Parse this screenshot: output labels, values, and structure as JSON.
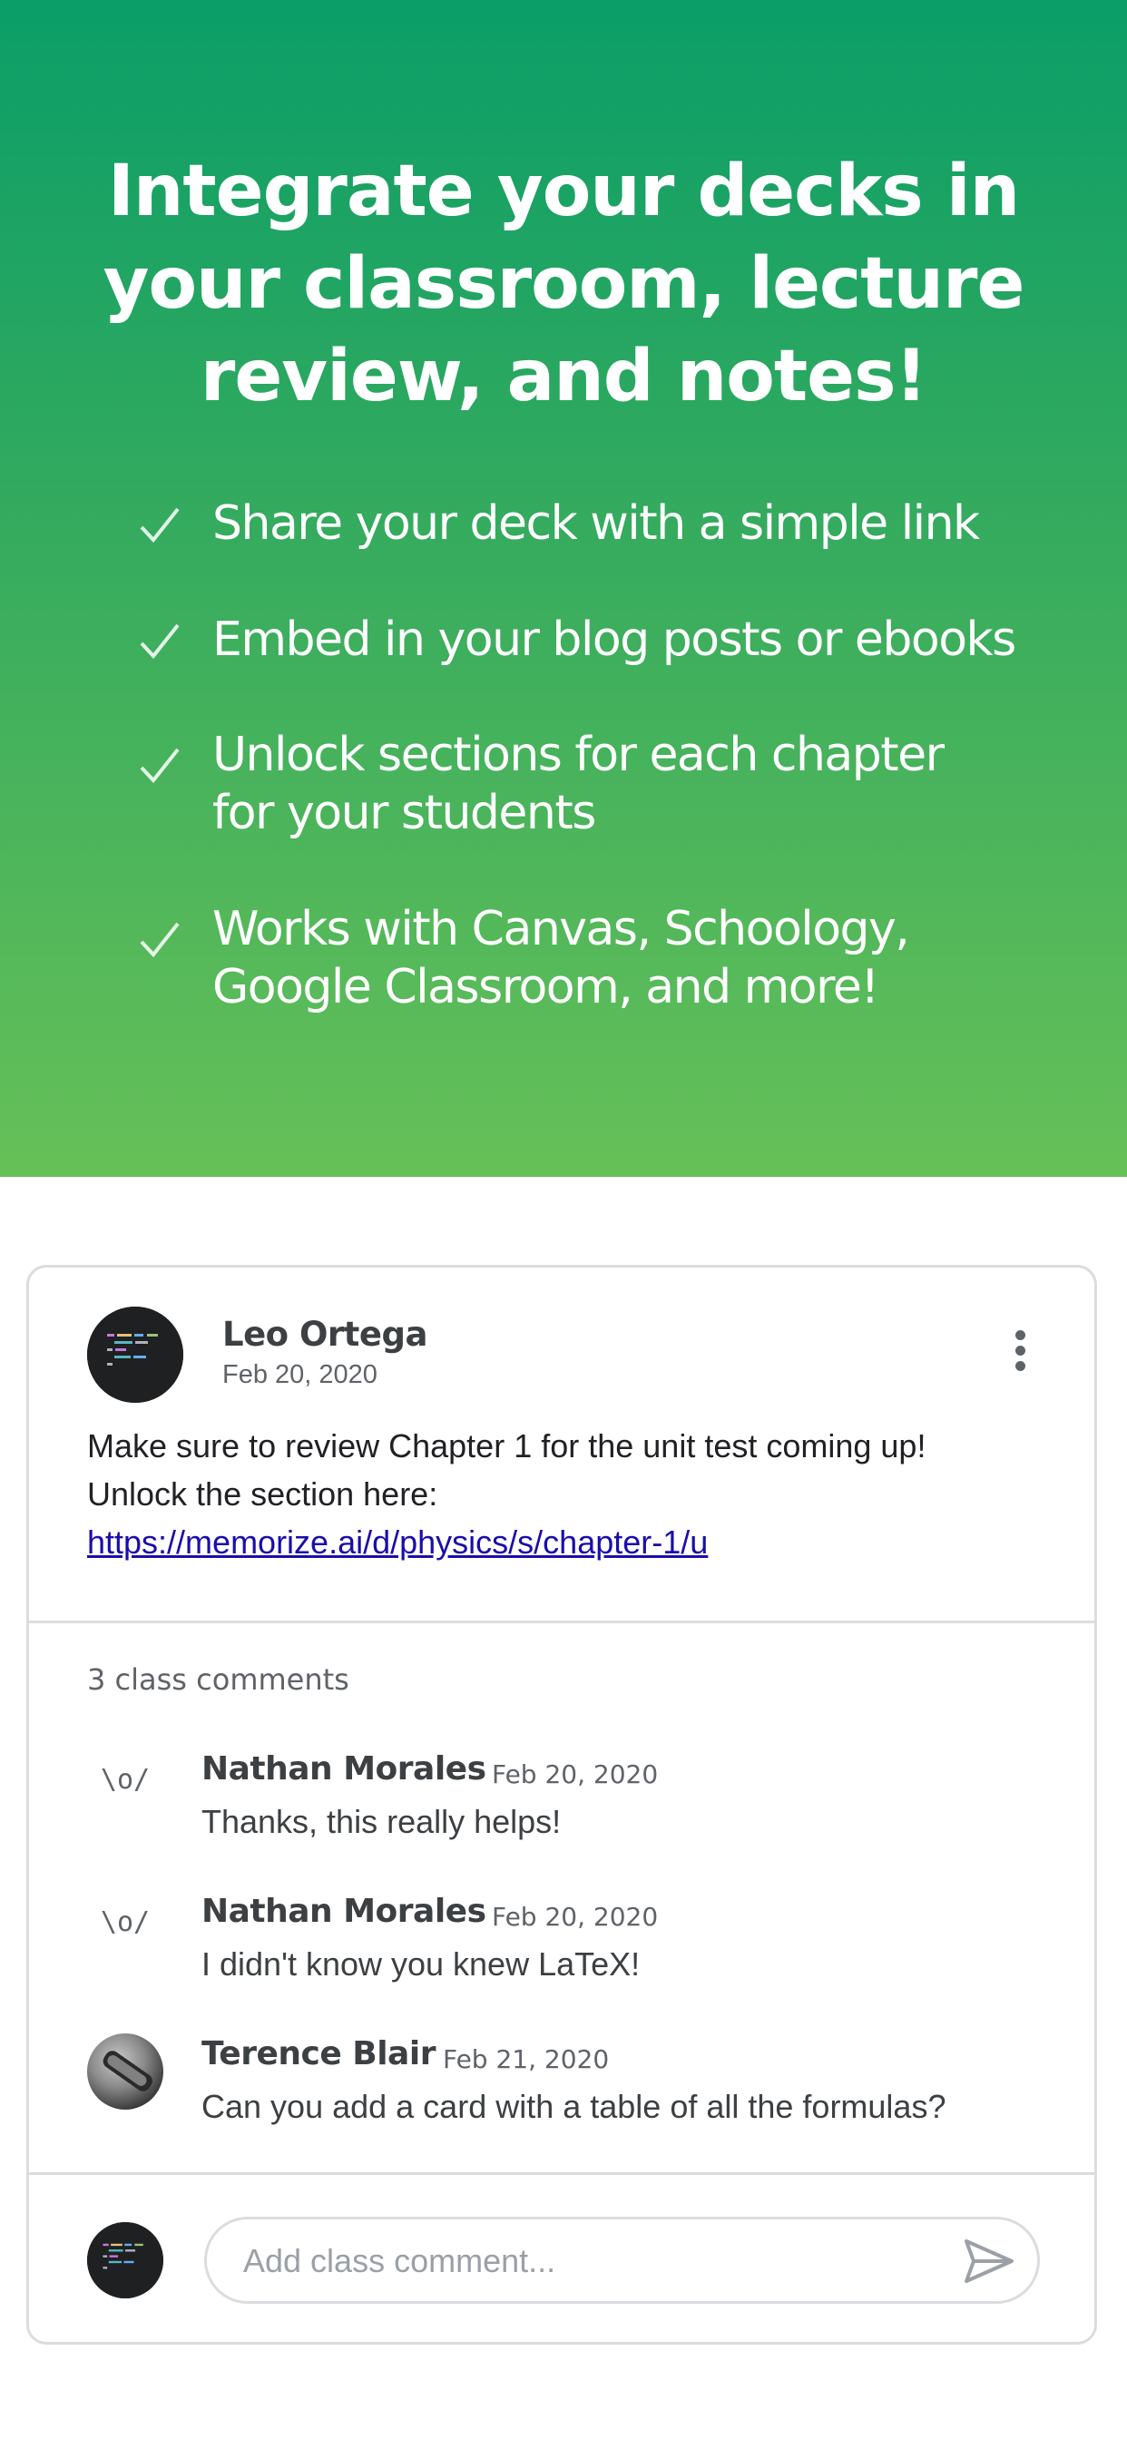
{
  "hero": {
    "title_lines": [
      "Integrate your decks in",
      "your classroom, lecture",
      "review, and notes!"
    ],
    "features": [
      {
        "lines": [
          "Share your deck with a simple link"
        ]
      },
      {
        "lines": [
          "Embed in your blog posts or ebooks"
        ]
      },
      {
        "lines": [
          "Unlock sections for each chapter",
          "for your students"
        ]
      },
      {
        "lines": [
          "Works with Canvas, Schoology,",
          "Google Classroom, and more!"
        ]
      }
    ],
    "check_icon": "check-icon",
    "gradient_colors": [
      "#0b9e68",
      "#66c058"
    ]
  },
  "post": {
    "author": "Leo Ortega",
    "date": "Feb 20, 2020",
    "body_lines": [
      "Make sure to review Chapter 1 for the unit test coming up!",
      "Unlock the section here:"
    ],
    "link": "https://memorize.ai/d/physics/s/chapter-1/u",
    "more_icon": "more-vert-icon"
  },
  "comments": {
    "count_label": "3 class comments",
    "items": [
      {
        "name": "Nathan Morales",
        "date": "Feb 20, 2020",
        "text": "Thanks, this really helps!",
        "avatar": "\\o/"
      },
      {
        "name": "Nathan Morales",
        "date": "Feb 20, 2020",
        "text": "I didn't know you knew LaTeX!",
        "avatar": "\\o/"
      },
      {
        "name": "Terence Blair",
        "date": "Feb 21, 2020",
        "text": "Can you add a card with a table of all the formulas?",
        "avatar": ""
      }
    ]
  },
  "composer": {
    "placeholder": "Add class comment...",
    "send_icon": "send-icon"
  },
  "colors": {
    "link": "#1a0dab",
    "text_dark": "#3c4043",
    "text_muted": "#5f6368",
    "border": "#dadce0"
  }
}
